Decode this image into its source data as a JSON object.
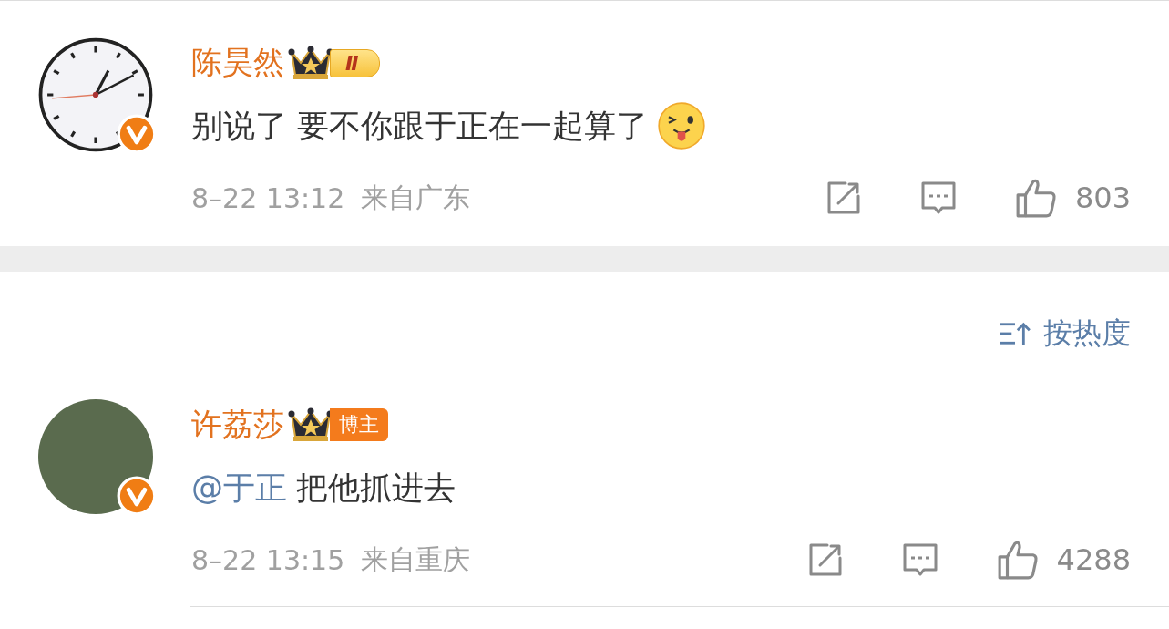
{
  "comments": [
    {
      "avatar": {
        "kind": "clock"
      },
      "verified": true,
      "name": "陈昊然",
      "badge": {
        "kind": "level",
        "label": "Ⅱ"
      },
      "segments": [
        {
          "kind": "text",
          "text": "别说了 要不你跟于正在一起算了"
        },
        {
          "kind": "emoji"
        }
      ],
      "time": "8–22 13:12",
      "location": "来自广东",
      "likes": "803"
    },
    {
      "avatar": {
        "kind": "photo"
      },
      "verified": true,
      "name": "许荔莎",
      "badge": {
        "kind": "role",
        "label": "博主"
      },
      "segments": [
        {
          "kind": "mention",
          "text": "@于正"
        },
        {
          "kind": "text",
          "text": "把他抓进去"
        }
      ],
      "time": "8–22 13:15",
      "location": "来自重庆",
      "likes": "4288"
    }
  ],
  "sort": {
    "label": "按热度"
  }
}
